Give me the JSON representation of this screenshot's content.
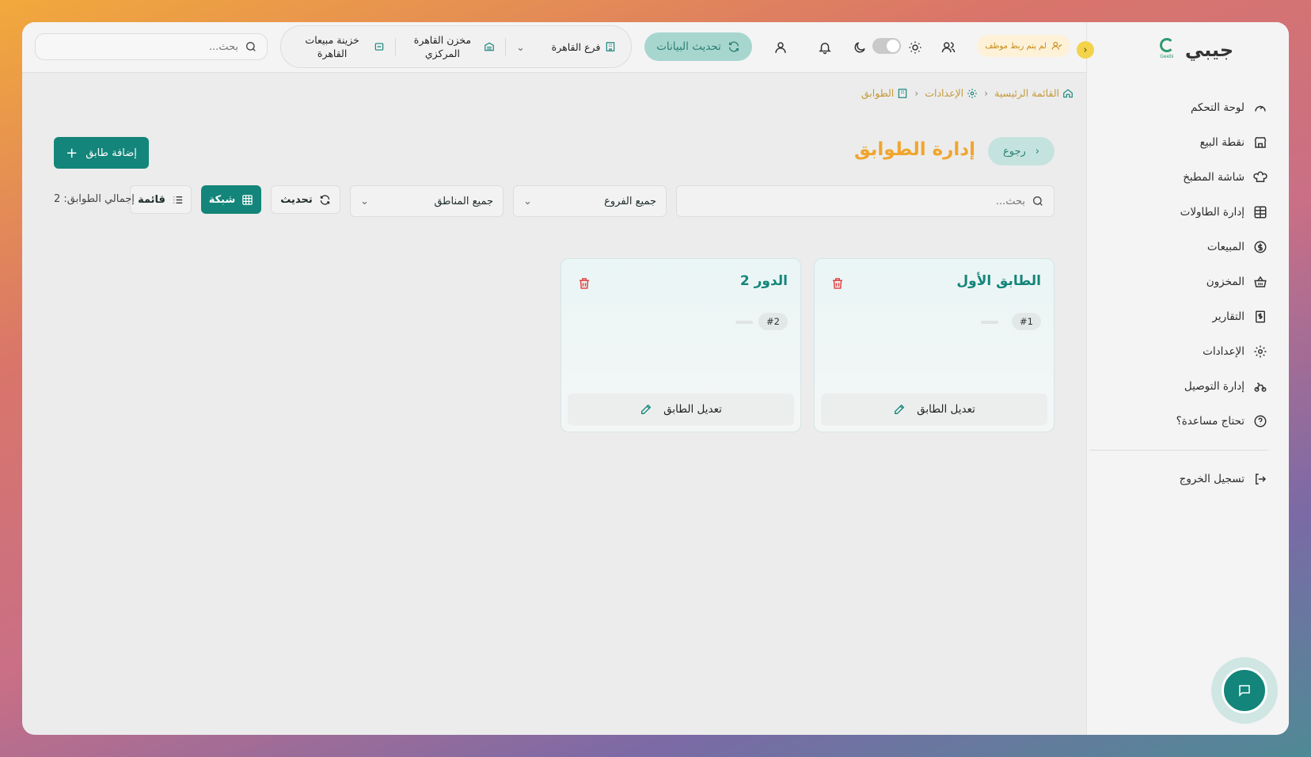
{
  "brand": {
    "name": "جيبي",
    "logo_text": "Geebi"
  },
  "sidebar": {
    "items": [
      {
        "label": "لوحة التحكم",
        "icon": "gauge-icon"
      },
      {
        "label": "نقطة البيع",
        "icon": "store-icon"
      },
      {
        "label": "شاشة المطبخ",
        "icon": "chef-hat-icon"
      },
      {
        "label": "إدارة الطاولات",
        "icon": "table-grid-icon"
      },
      {
        "label": "المبيعات",
        "icon": "dollar-circle-icon"
      },
      {
        "label": "المخزون",
        "icon": "basket-icon"
      },
      {
        "label": "التقارير",
        "icon": "receipt-icon"
      },
      {
        "label": "الإعدادات",
        "icon": "gear-icon"
      },
      {
        "label": "إدارة التوصيل",
        "icon": "bike-icon"
      },
      {
        "label": "تحتاج مساعدة؟",
        "icon": "help-circle-icon"
      }
    ],
    "logout": "تسجيل الخروج"
  },
  "topbar": {
    "staff_badge": "لم يتم ربط موظف",
    "sync_label": "تحديث البيانات",
    "branch": "فرع القاهرة",
    "warehouse": "مخزن القاهرة المركزي",
    "register": "خزينة مبيعات القاهرة",
    "search_placeholder": "بحث..."
  },
  "breadcrumb": {
    "home": "القائمة الرئيسية",
    "settings": "الإعدادات",
    "current": "الطوابق"
  },
  "page": {
    "back_label": "رجوع",
    "title": "إدارة الطوابق",
    "add_label": "إضافة طابق"
  },
  "filters": {
    "search_placeholder": "بحث...",
    "branches": "جميع الفروع",
    "regions": "جميع المناطق",
    "refresh": "تحديث",
    "grid": "شبكة",
    "list": "قائمة",
    "total": "إجمالي الطوابق: 2"
  },
  "floors": [
    {
      "name": "الطابق الأول",
      "number": "#1",
      "edit_label": "تعديل الطابق"
    },
    {
      "name": "الدور 2",
      "number": "#2",
      "edit_label": "تعديل الطابق"
    }
  ],
  "colors": {
    "accent": "#13857a",
    "title": "#f0a52e",
    "danger": "#e04545"
  }
}
